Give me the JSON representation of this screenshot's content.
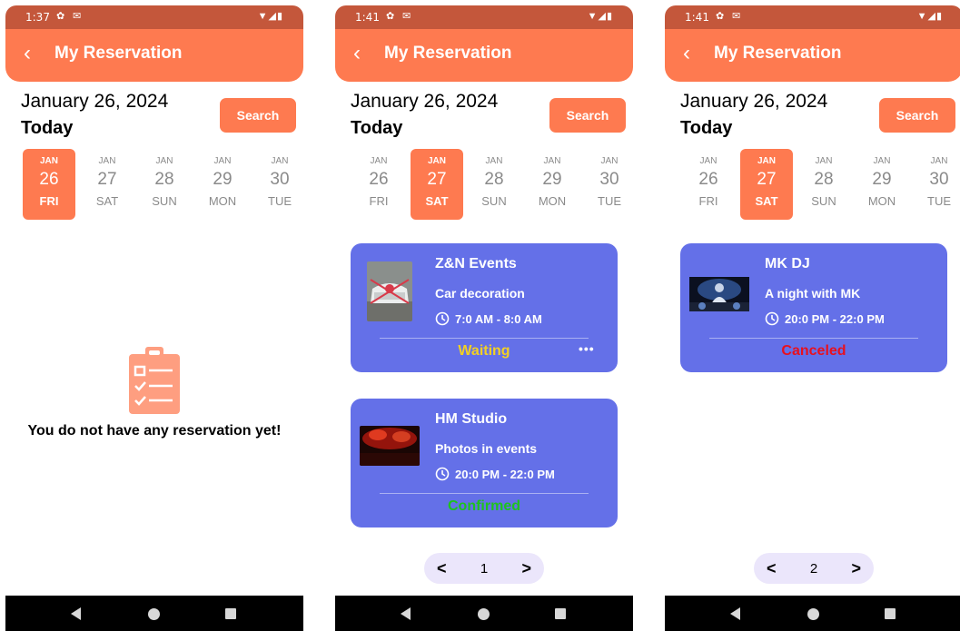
{
  "screens": [
    {
      "status_time": "1:37",
      "header_title": "My Reservation",
      "date_title": "January 26, 2024",
      "today_label": "Today",
      "search_label": "Search",
      "days": [
        {
          "month": "JAN",
          "day": "26",
          "weekday": "FRI"
        },
        {
          "month": "JAN",
          "day": "27",
          "weekday": "SAT"
        },
        {
          "month": "JAN",
          "day": "28",
          "weekday": "SUN"
        },
        {
          "month": "JAN",
          "day": "29",
          "weekday": "MON"
        },
        {
          "month": "JAN",
          "day": "30",
          "weekday": "TUE"
        }
      ],
      "selected_day": "26",
      "empty_message": "You do not have any reservation yet!"
    },
    {
      "status_time": "1:41",
      "header_title": "My Reservation",
      "date_title": "January 26, 2024",
      "today_label": "Today",
      "search_label": "Search",
      "days": [
        {
          "month": "JAN",
          "day": "26",
          "weekday": "FRI"
        },
        {
          "month": "JAN",
          "day": "27",
          "weekday": "SAT"
        },
        {
          "month": "JAN",
          "day": "28",
          "weekday": "SUN"
        },
        {
          "month": "JAN",
          "day": "29",
          "weekday": "MON"
        },
        {
          "month": "JAN",
          "day": "30",
          "weekday": "TUE"
        }
      ],
      "selected_day": "27",
      "reservations": [
        {
          "name": "Z&N Events",
          "service": "Car decoration",
          "time": "7:0 AM - 8:0 AM",
          "status": "Waiting",
          "status_color": "#f2d024",
          "more": "•••"
        },
        {
          "name": "HM Studio",
          "service": "Photos in events",
          "time": "20:0 PM - 22:0 PM",
          "status": "Confirmed",
          "status_color": "#1ec21e"
        }
      ],
      "page": "1"
    },
    {
      "status_time": "1:41",
      "header_title": "My Reservation",
      "date_title": "January 26, 2024",
      "today_label": "Today",
      "search_label": "Search",
      "days": [
        {
          "month": "JAN",
          "day": "26",
          "weekday": "FRI"
        },
        {
          "month": "JAN",
          "day": "27",
          "weekday": "SAT"
        },
        {
          "month": "JAN",
          "day": "28",
          "weekday": "SUN"
        },
        {
          "month": "JAN",
          "day": "29",
          "weekday": "MON"
        },
        {
          "month": "JAN",
          "day": "30",
          "weekday": "TUE"
        }
      ],
      "selected_day": "27",
      "reservations": [
        {
          "name": "MK DJ",
          "service": "A night with MK",
          "time": "20:0 PM - 22:0 PM",
          "status": "Canceled",
          "status_color": "#e8101e"
        }
      ],
      "page": "2"
    }
  ],
  "colors": {
    "accent": "#fe7a50",
    "card": "#6470e8",
    "pager_bg": "#ebe6fb"
  },
  "icons": {
    "back": "chevron-left-icon",
    "empty": "clipboard-list-icon",
    "clock": "clock-icon",
    "prev": "chevron-left-icon",
    "next": "chevron-right-icon"
  }
}
